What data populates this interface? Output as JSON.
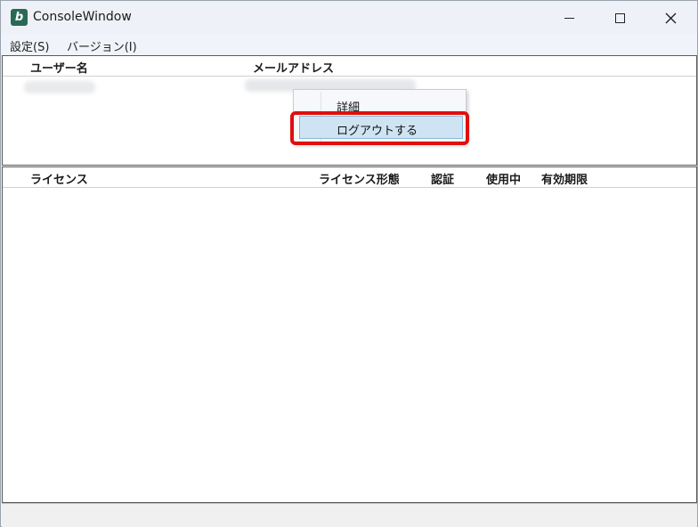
{
  "window": {
    "title": "ConsoleWindow",
    "app_icon_letter": "b"
  },
  "menu": [
    {
      "label": "設定(S)"
    },
    {
      "label": "バージョン(I)"
    }
  ],
  "user_table": {
    "columns": [
      "ユーザー名",
      "メールアドレス"
    ]
  },
  "context_menu": {
    "items": [
      {
        "label": "詳細"
      },
      {
        "label": "ログアウトする",
        "highlighted": true
      }
    ]
  },
  "license_table": {
    "columns": [
      "ライセンス",
      "ライセンス形態",
      "認証",
      "使用中",
      "有効期限"
    ]
  },
  "colors": {
    "highlight_ring": "#e00e0e",
    "app_icon_bg": "#2a6a55",
    "selected_item_bg": "#cfe4f2"
  }
}
